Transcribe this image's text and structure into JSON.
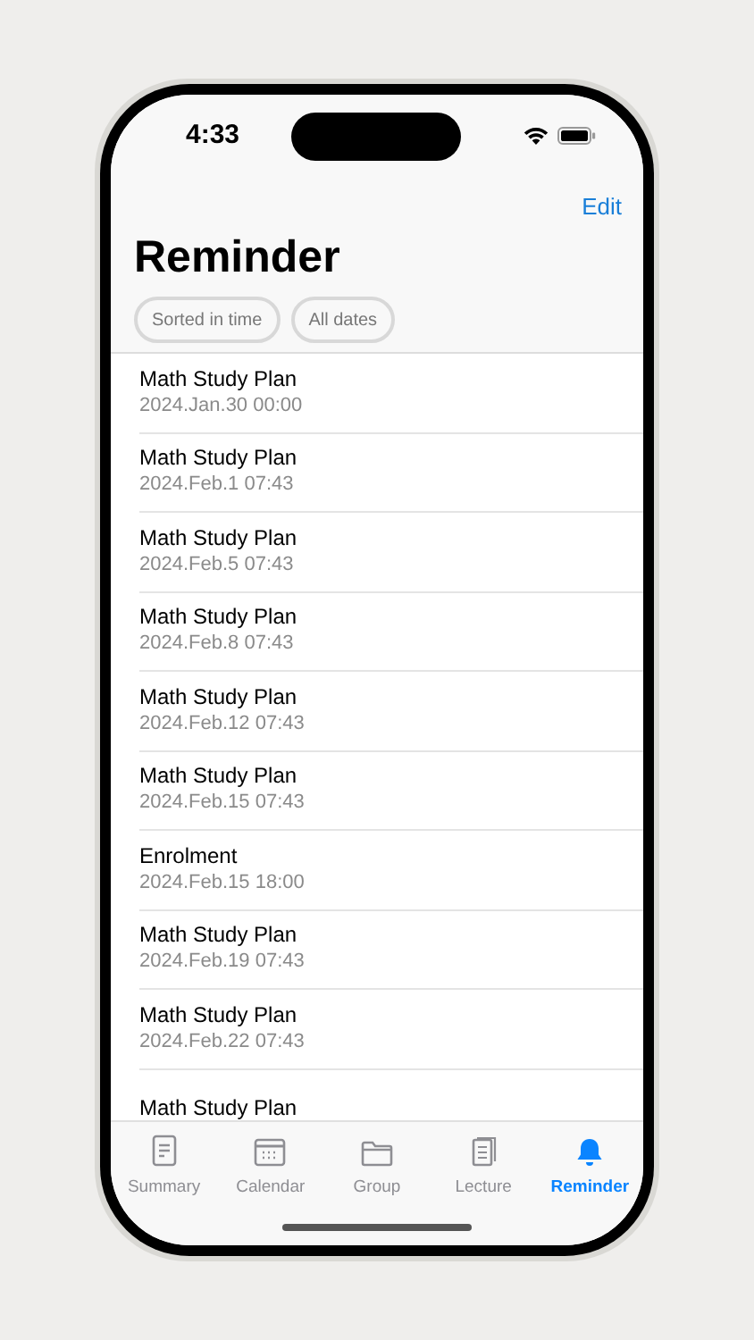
{
  "status_bar": {
    "time": "4:33"
  },
  "nav": {
    "action": "Edit",
    "title": "Reminder"
  },
  "filters": [
    {
      "label": "Sorted in time"
    },
    {
      "label": "All dates"
    }
  ],
  "reminders": [
    {
      "title": "Math Study Plan",
      "date": "2024.Jan.30 00:00"
    },
    {
      "title": "Math Study Plan",
      "date": "2024.Feb.1 07:43"
    },
    {
      "title": "Math Study Plan",
      "date": "2024.Feb.5 07:43"
    },
    {
      "title": "Math Study Plan",
      "date": "2024.Feb.8 07:43"
    },
    {
      "title": "Math Study Plan",
      "date": "2024.Feb.12 07:43"
    },
    {
      "title": "Math Study Plan",
      "date": "2024.Feb.15 07:43"
    },
    {
      "title": "Enrolment",
      "date": "2024.Feb.15 18:00"
    },
    {
      "title": "Math Study Plan",
      "date": "2024.Feb.19 07:43"
    },
    {
      "title": "Math Study Plan",
      "date": "2024.Feb.22 07:43"
    },
    {
      "title": "Math Study Plan"
    }
  ],
  "tabs": [
    {
      "label": "Summary",
      "kind": "summary",
      "selected": false
    },
    {
      "label": "Calendar",
      "kind": "calendar",
      "selected": false
    },
    {
      "label": "Group",
      "kind": "group",
      "selected": false
    },
    {
      "label": "Lecture",
      "kind": "lecture",
      "selected": false
    },
    {
      "label": "Reminder",
      "kind": "reminder",
      "selected": true
    }
  ]
}
